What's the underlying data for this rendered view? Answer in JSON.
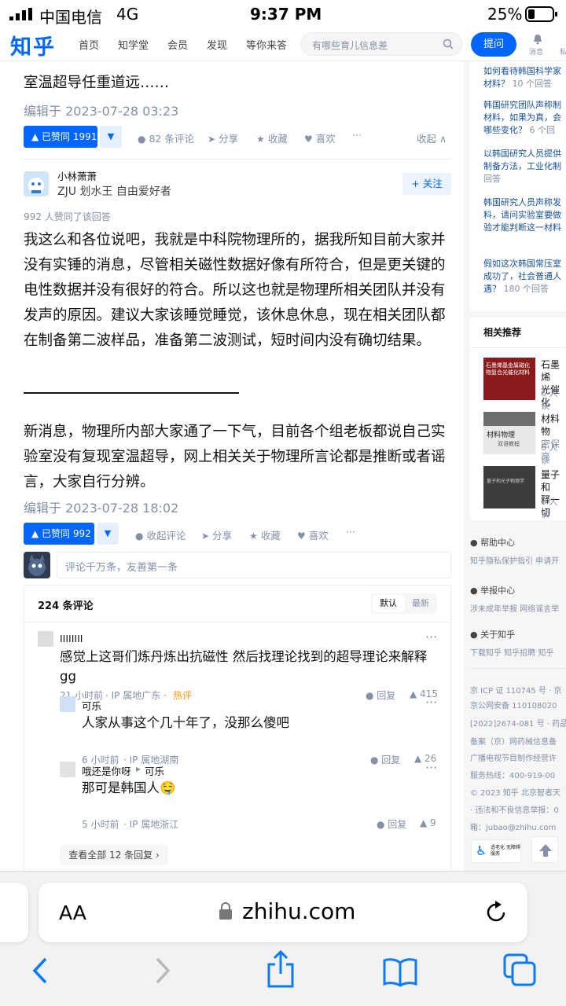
{
  "status": {
    "carrier": "中国电信",
    "network": "4G",
    "time": "9:37 PM",
    "battery": "25%"
  },
  "header": {
    "logo": "知乎",
    "nav": [
      "首页",
      "知学堂",
      "会员",
      "发现",
      "等你来答"
    ],
    "search_placeholder": "有哪些育儿信息差",
    "ask_label": "提问",
    "messages_label": "消息",
    "private_label": "私"
  },
  "answer1": {
    "last_line": "室温超导任重道远……",
    "edited": "编辑于 2023-07-28 03:23",
    "vote_label": "▲ 已赞同 1991",
    "comments": "82 条评论",
    "share": "分享",
    "collect": "收藏",
    "like": "喜欢",
    "more": "···",
    "collapse": "收起 ∧"
  },
  "answer2": {
    "author": "小林萧萧",
    "bio": "ZJU 划水王 自由爱好者",
    "follow": "+ 关注",
    "upvoters": "992 人赞同了该回答",
    "para1": "我这么和各位说吧，我就是中科院物理所的，据我所知目前大家并没有实锤的消息，尽管相关磁性数据好像有所符合，但是更关键的电性数据并没有很好的符合。所以这也就是物理所相关团队并没有发声的原因。建议大家该睡觉睡觉，该休息休息，现在相关团队都在制备第二波样品，准备第二波测试，短时间内没有确切结果。",
    "divider": "————————————————",
    "para2": "新消息，物理所内部大家通了一下气，目前各个组老板都说自己实验室没有复现室温超导，网上相关关于物理所言论都是推断或者谣言，大家自行分辨。",
    "edited": "编辑于 2023-07-28 18:02",
    "vote_label": "▲ 已赞同 992",
    "fold_comments": "收起评论",
    "share": "分享",
    "collect": "收藏",
    "like": "喜欢",
    "more": "···"
  },
  "comment_box": {
    "placeholder": "评论千万条，友善第一条"
  },
  "comments": {
    "count": "224 条评论",
    "sort_default": "默认",
    "sort_latest": "最新",
    "items": [
      {
        "name": "IIIIIIII",
        "text": "感觉上这哥们炼丹炼出抗磁性 然后找理论找到的超导理论来解释 gg",
        "time": "21 小时前",
        "ip": "IP 属地广东",
        "tag": "热评",
        "reply": "回复",
        "likes": "415"
      },
      {
        "name": "可乐",
        "text": "人家从事这个几十年了，没那么傻吧",
        "time": "6 小时前",
        "ip": "IP 属地湖南",
        "reply": "回复",
        "likes": "26"
      },
      {
        "name": "哦还是你呀",
        "reply_to": "可乐",
        "text": "那可是韩国人🤤",
        "time": "5 小时前",
        "ip": "IP 属地浙江",
        "reply": "回复",
        "likes": "9"
      }
    ],
    "view_all": "查看全部 12 条回复 ›"
  },
  "sidebar": {
    "questions": [
      {
        "title1": "如何看待韩国科学家",
        "title2": "材料？",
        "meta": "10 个回答"
      },
      {
        "title1": "韩国研究团队声称制",
        "title2": "材料，如果为真，会",
        "title3": "哪些变化？",
        "meta": "6 个回"
      },
      {
        "title1": "以韩国研究人员提供",
        "title2": "制备方法，工业化制",
        "meta": "回答"
      },
      {
        "title1": "韩国研究人员声称发",
        "title2": "料，请问实验室要做",
        "title3": "验才能判断这一材料"
      },
      {
        "title1": "假如这次韩国常压室",
        "title2": "成功了，社会普通人",
        "title3": "遇？",
        "meta": "180 个回答"
      }
    ],
    "recommend_title": "相关推荐",
    "books": [
      {
        "cover": "石墨烯基金属磁化物复合光催化材料",
        "title1": "石墨烯",
        "title2": "光催化",
        "meta": "6 人读"
      },
      {
        "cover": "材料物理",
        "cover_sub": "双语教程",
        "title1": "材料物",
        "title2": "密保亮",
        "meta": "6 人读"
      },
      {
        "cover": "量子和光子物理学",
        "title1": "量子和",
        "title2": "释一切",
        "meta": "6 人读"
      }
    ],
    "help_center": "帮助中心",
    "help_links": "知乎隐私保护指引  申请开",
    "report_center": "举报中心",
    "report_links": "涉未成年举报  网络谣言举",
    "about": "关于知乎",
    "about_links": "下载知乎  知乎招聘  知乎",
    "footer": [
      "京 ICP 证 110745 号 · 京",
      "京公网安备 110108020",
      "[2022]2674-081 号 · 药品",
      "备案（京）网药械信息备",
      "广播电视节目制作经营许",
      "服务热线：400-919-00",
      "© 2023 知乎 北京智者天",
      "· 违法和不良信息举报：0",
      "箱：jubao@zhihu.com"
    ],
    "elder_mode": "适老化 无障碍服务"
  },
  "safari": {
    "aa": "AA",
    "url": "zhihu.com"
  }
}
